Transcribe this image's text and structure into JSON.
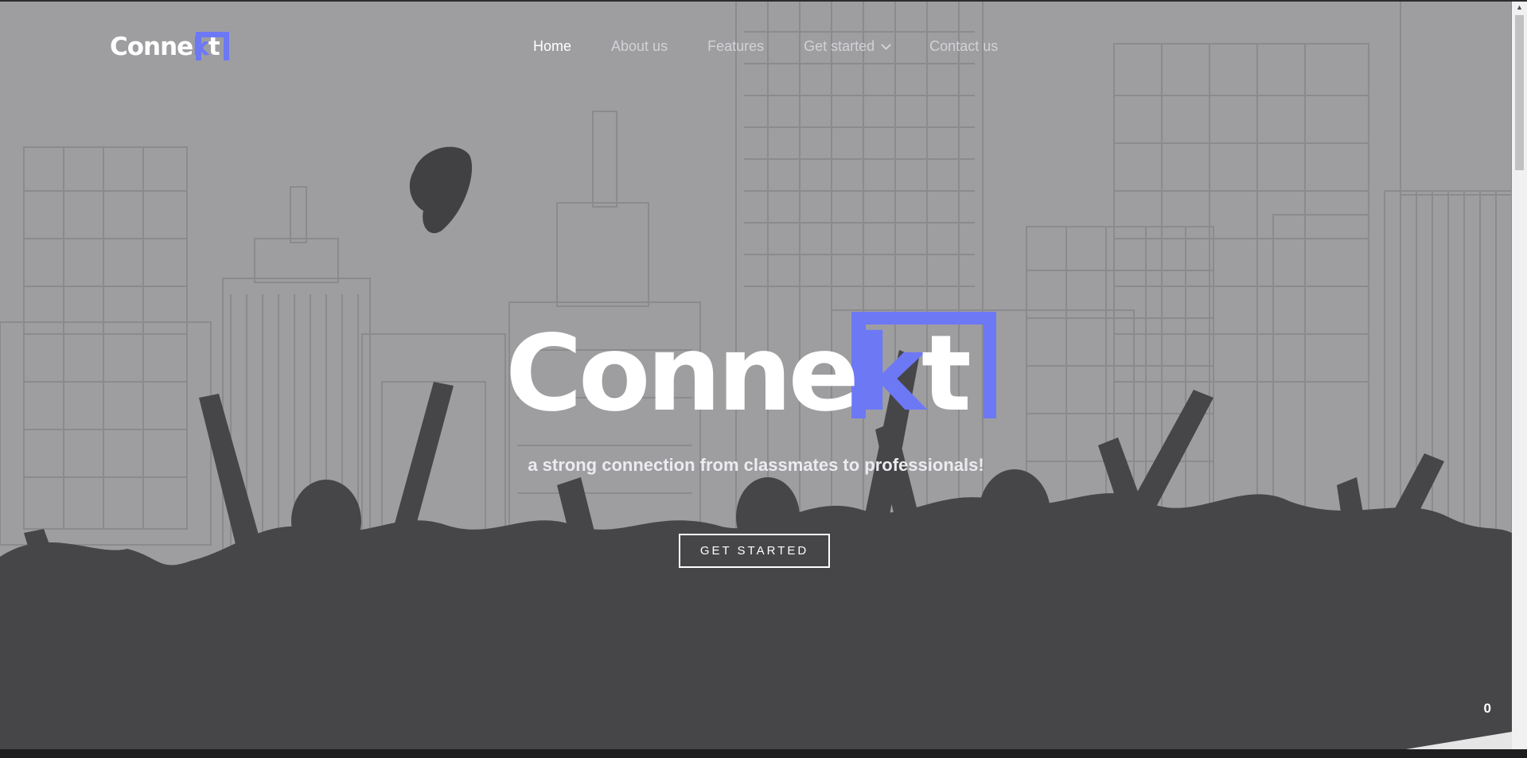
{
  "brand": {
    "logo_prefix": "Conne",
    "logo_accent": "k",
    "logo_suffix": "t",
    "accent_color": "#6d78f5"
  },
  "nav": {
    "items": [
      {
        "label": "Home",
        "active": true
      },
      {
        "label": "About us"
      },
      {
        "label": "Features"
      },
      {
        "label": "Get started",
        "has_dropdown": true
      },
      {
        "label": "Contact us"
      }
    ]
  },
  "hero": {
    "tagline": "a strong connection from classmates to professionals!",
    "cta_label": "GET STARTED"
  },
  "counter": "0",
  "icons": {
    "dropdown": "chevron-down-icon",
    "scroll_up": "arrow-up-icon",
    "scroll_down": "arrow-down-icon"
  }
}
